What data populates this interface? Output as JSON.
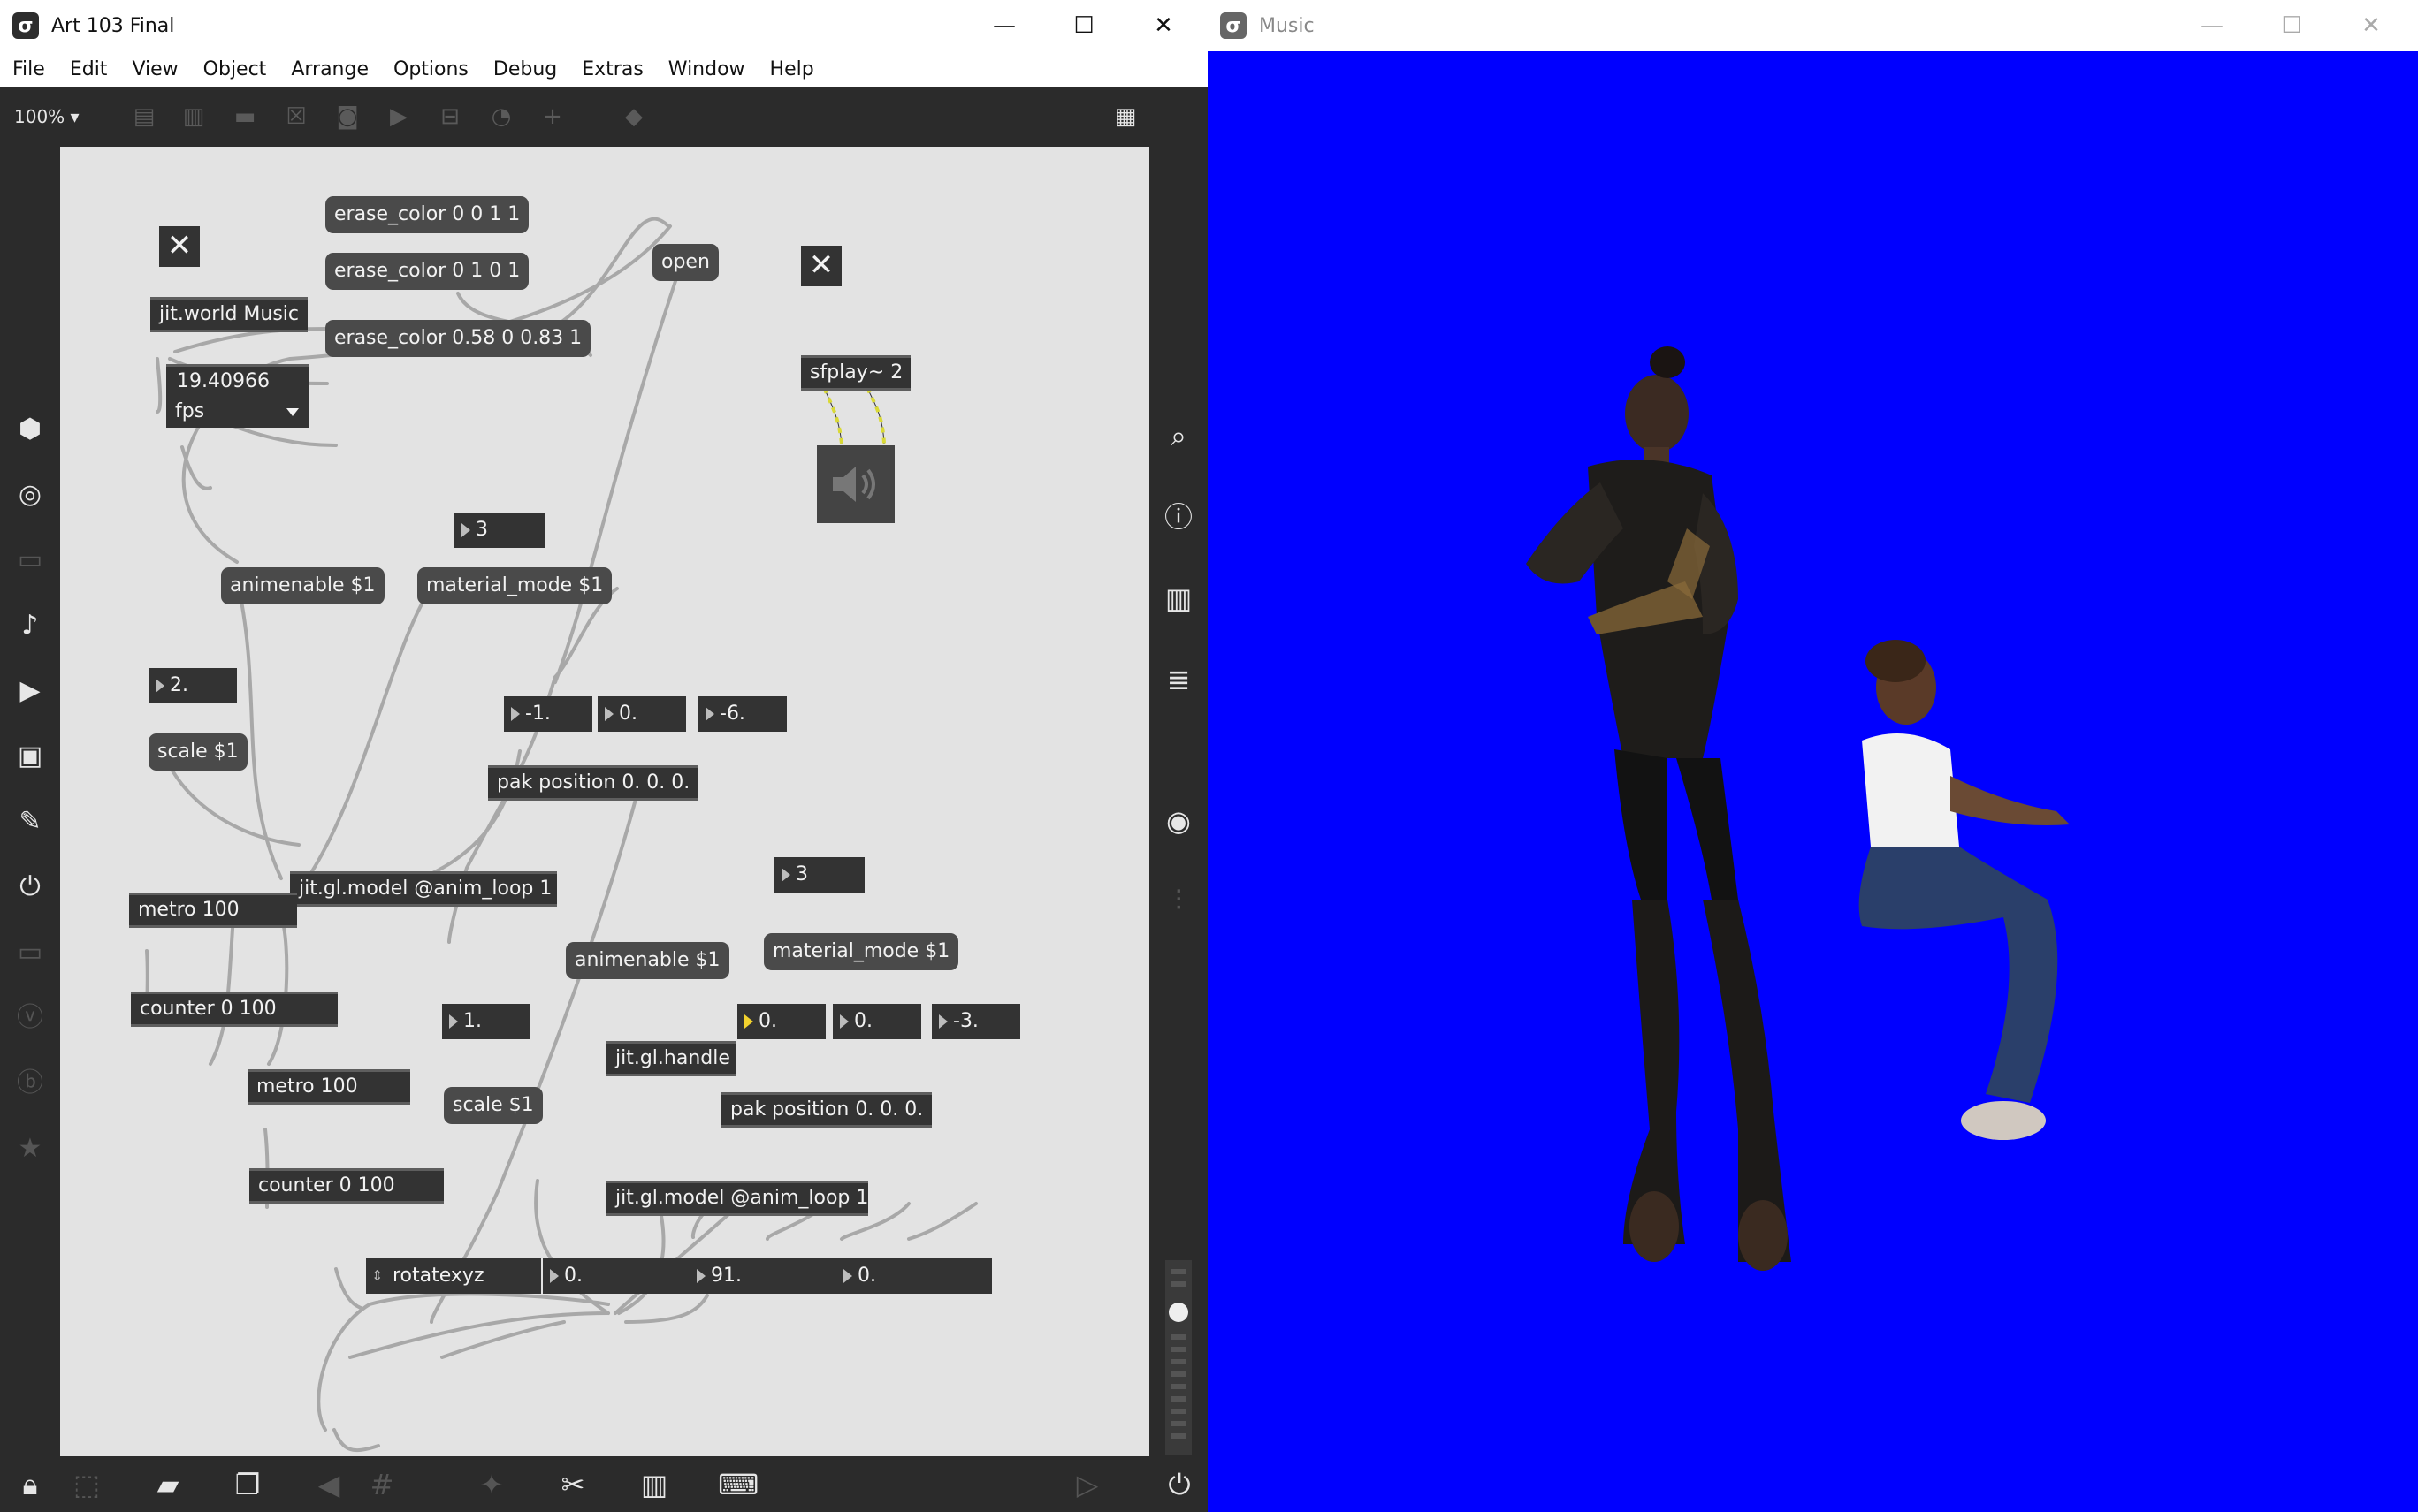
{
  "max_window": {
    "title": "Art 103 Final",
    "menu": [
      "File",
      "Edit",
      "View",
      "Object",
      "Arrange",
      "Options",
      "Debug",
      "Extras",
      "Window",
      "Help"
    ],
    "zoom": "100%",
    "objects": {
      "erase1": "erase_color 0 0 1 1",
      "erase2": "erase_color 0 1 0 1",
      "erase3": "erase_color 0.58 0 0.83 1",
      "world": "jit.world Music",
      "fps_value": "19.40966",
      "fps_menu": "fps",
      "open": "open",
      "sfplay": "sfplay~ 2",
      "num3a": "3",
      "animenable_a": "animenable $1",
      "material_a": "material_mode $1",
      "num2": "2.",
      "scale_a": "scale $1",
      "n_neg1": "-1.",
      "n_0a": "0.",
      "n_neg6": "-6.",
      "pak_a": "pak position 0. 0. 0.",
      "model_a": "jit.gl.model @anim_loop 1",
      "metro_a": "metro 100",
      "counter_a": "counter 0 100",
      "num3b": "3",
      "material_b": "material_mode $1",
      "animenable_b": "animenable $1",
      "num1": "1.",
      "handle": "jit.gl.handle",
      "n_0b": "0.",
      "n_0c": "0.",
      "n_neg3": "-3.",
      "scale_b": "scale $1",
      "pak_b": "pak position 0. 0. 0.",
      "metro_b": "metro 100",
      "counter_b": "counter 0 100",
      "model_b": "jit.gl.model @anim_loop 1",
      "rotatexyz": "rotatexyz",
      "rot_x": "0.",
      "rot_y": "91.",
      "rot_z": "0."
    }
  },
  "music_window": {
    "title": "Music",
    "background_color": "#0000ff"
  },
  "colors": {
    "patch_bg": "#e3e3e3",
    "object_bg": "#333333",
    "message_bg": "#4a4a4a",
    "cord": "#a8a8a8",
    "signal_cord": "#d9d935",
    "accent": "#f2d22e"
  }
}
